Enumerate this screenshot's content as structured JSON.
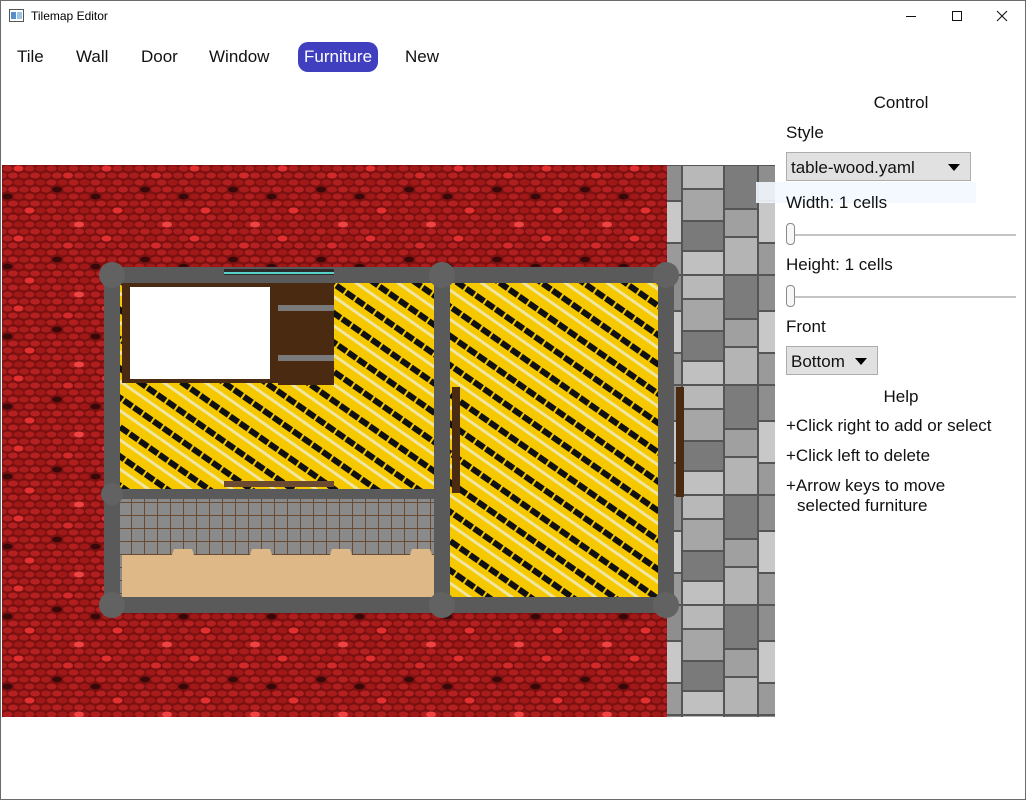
{
  "window": {
    "title": "Tilemap Editor",
    "controls": {
      "minimize_icon": "minimize-icon",
      "maximize_icon": "maximize-icon",
      "close_icon": "close-icon"
    }
  },
  "menu": {
    "items": [
      {
        "label": "Tile"
      },
      {
        "label": "Wall"
      },
      {
        "label": "Door"
      },
      {
        "label": "Window"
      },
      {
        "label": "Furniture"
      },
      {
        "label": "New"
      }
    ],
    "active": "Furniture",
    "active_color": "#3f3fbf"
  },
  "control": {
    "heading": "Control",
    "style_label": "Style",
    "style_value": "table-wood.yaml",
    "width_label": "Width: 1 cells",
    "width_value": 1,
    "height_label": "Height: 1 cells",
    "height_value": 1,
    "front_label": "Front",
    "front_value": "Bottom"
  },
  "help": {
    "heading": "Help",
    "lines": [
      "+Click right to add or select",
      "+Click left to delete",
      "+Arrow keys to move",
      "selected furniture"
    ]
  },
  "map": {
    "colors": {
      "brick": "#a41c1c",
      "mortar": "#7a1010",
      "wall": "#5a5a5a",
      "floor_yellow": "#f5c800",
      "floor_black": "#111111",
      "furniture_wood": "#4a2a10",
      "counter": "#deb887",
      "kitchen_tile": "#8a8a8a",
      "stone": "#a0a0a0"
    }
  }
}
